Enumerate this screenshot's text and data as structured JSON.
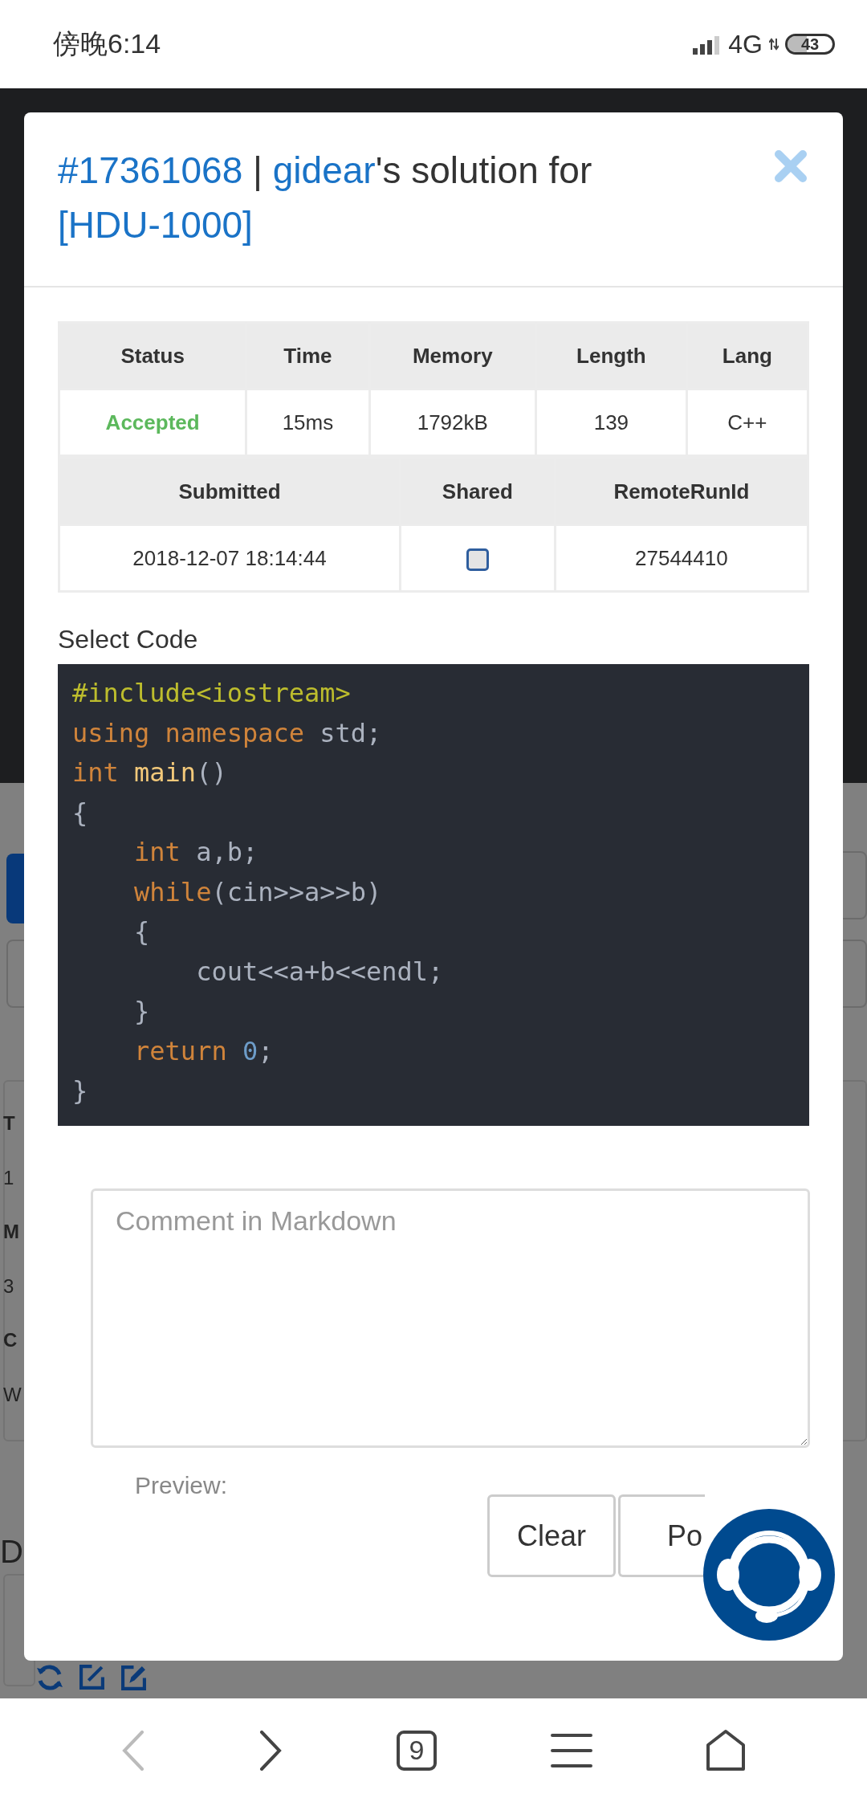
{
  "status_bar": {
    "time": "傍晚6:14",
    "network": "4G",
    "battery": "43"
  },
  "background": {
    "fragments": [
      {
        "text": "T",
        "bold": true
      },
      {
        "text": "1",
        "bold": false
      },
      {
        "text": "M",
        "bold": true
      },
      {
        "text": "3",
        "bold": false
      },
      {
        "text": "C",
        "bold": true
      },
      {
        "text": "W",
        "bold": false
      }
    ],
    "heading": "D"
  },
  "modal": {
    "title": [
      {
        "text": "#17361068",
        "kind": "link"
      },
      {
        "text": " | ",
        "kind": "text"
      },
      {
        "text": "gidear",
        "kind": "link"
      },
      {
        "text": "'s solution for ",
        "kind": "text"
      },
      {
        "text": "[HDU-1000]",
        "kind": "link"
      }
    ],
    "summary": [
      {
        "columns": [
          "Status",
          "Time",
          "Memory",
          "Length",
          "Lang"
        ],
        "cells": [
          {
            "kind": "status",
            "text": "Accepted"
          },
          {
            "kind": "text",
            "text": "15ms"
          },
          {
            "kind": "text",
            "text": "1792kB"
          },
          {
            "kind": "text",
            "text": "139"
          },
          {
            "kind": "text",
            "text": "C++"
          }
        ]
      },
      {
        "columns": [
          "Submitted",
          "Shared",
          "RemoteRunId"
        ],
        "cells": [
          {
            "kind": "text",
            "text": "2018-12-07 18:14:44"
          },
          {
            "kind": "checkbox",
            "checked": false
          },
          {
            "kind": "text",
            "text": "27544410"
          }
        ]
      }
    ],
    "code_label": "Select Code",
    "code": [
      [
        {
          "kind": "meta",
          "text": "#include<iostream>"
        }
      ],
      [
        {
          "kind": "keyword",
          "text": "using"
        },
        {
          "kind": "keyword",
          "text": " namespace"
        },
        {
          "kind": "plain",
          "text": " std;"
        }
      ],
      [
        {
          "kind": "keyword",
          "text": "int"
        },
        {
          "kind": "title",
          "text": " main"
        },
        {
          "kind": "plain",
          "text": "()"
        }
      ],
      [
        {
          "kind": "plain",
          "text": "{"
        }
      ],
      [
        {
          "kind": "keyword",
          "text": "    int"
        },
        {
          "kind": "plain",
          "text": " a,b;"
        }
      ],
      [
        {
          "kind": "keyword",
          "text": "    while"
        },
        {
          "kind": "plain",
          "text": "(cin>>a>>b)"
        }
      ],
      [
        {
          "kind": "plain",
          "text": "    {"
        }
      ],
      [
        {
          "kind": "plain",
          "text": "        cout<<a+b<<endl;"
        }
      ],
      [
        {
          "kind": "plain",
          "text": "    }"
        }
      ],
      [
        {
          "kind": "keyword",
          "text": "    return"
        },
        {
          "kind": "number",
          "text": " 0"
        },
        {
          "kind": "plain",
          "text": ";"
        }
      ],
      [
        {
          "kind": "plain",
          "text": "}"
        }
      ]
    ],
    "comment": {
      "placeholder": "Comment in Markdown"
    },
    "preview_label": "Preview:",
    "buttons": [
      "Clear",
      "Po"
    ]
  },
  "nav_bar": [
    {
      "kind": "back",
      "disabled": true
    },
    {
      "kind": "forward",
      "disabled": false
    },
    {
      "kind": "tabs",
      "label": "9",
      "disabled": false
    },
    {
      "kind": "menu",
      "disabled": false
    },
    {
      "kind": "home",
      "disabled": false
    }
  ]
}
